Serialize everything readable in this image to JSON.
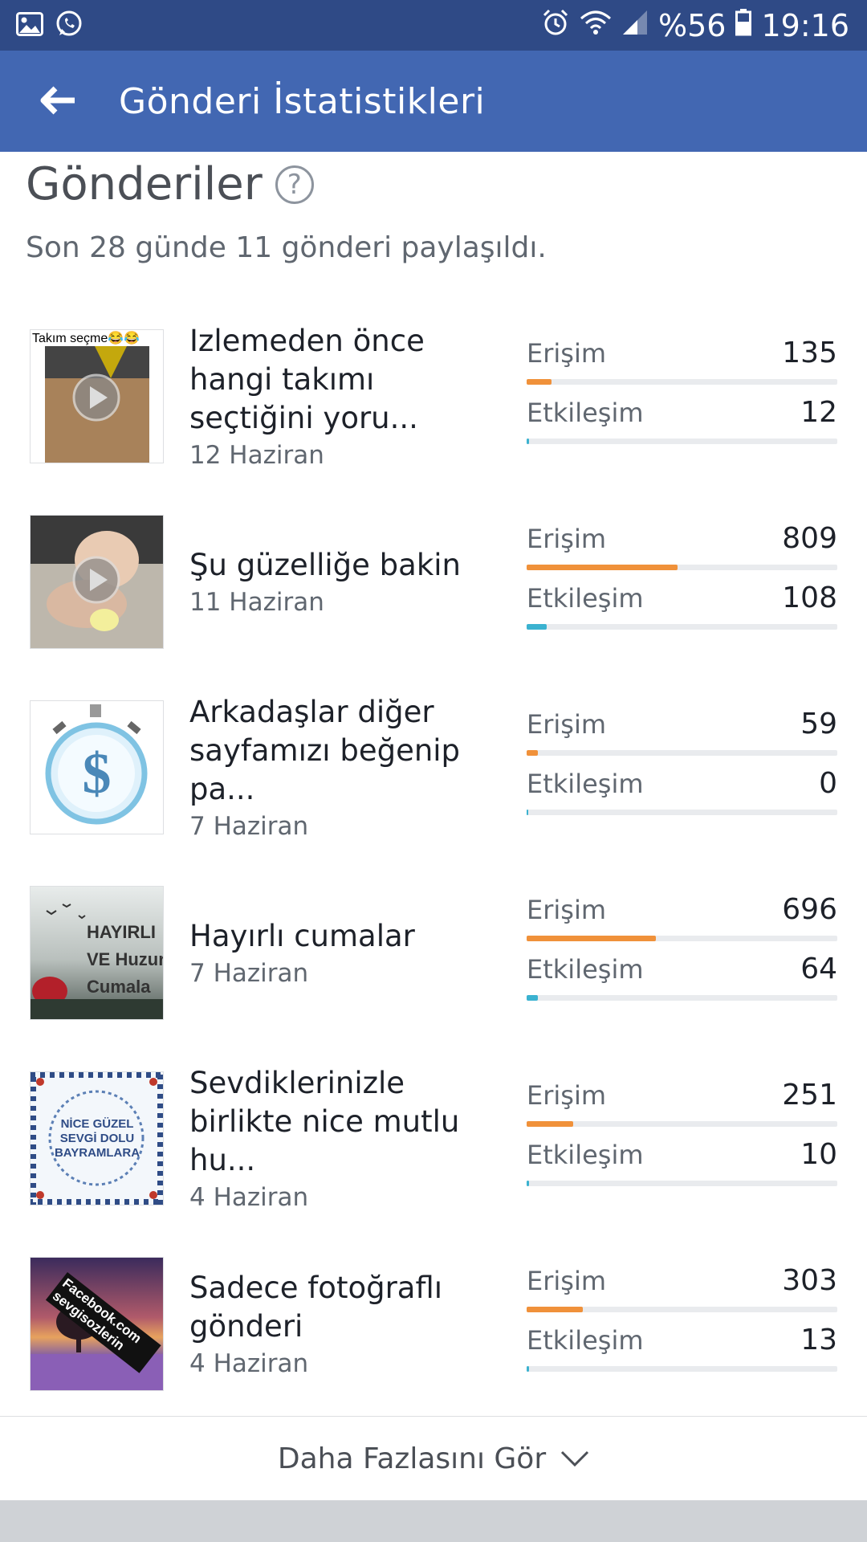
{
  "status_bar": {
    "battery_text": "%56",
    "time": "19:16",
    "icons": [
      "image-icon",
      "whatsapp-icon",
      "alarm-icon",
      "wifi-icon",
      "signal-icon",
      "battery-icon"
    ]
  },
  "app_bar": {
    "title": "Gönderi İstatistikleri",
    "back_icon": "back-arrow-icon",
    "color": "#4267b2"
  },
  "section": {
    "title": "Gönderiler",
    "help_glyph": "?",
    "subtitle": "Son 28 günde 11 gönderi paylaşıldı."
  },
  "metric_labels": {
    "reach": "Erişim",
    "engagement": "Etkileşim"
  },
  "colors": {
    "reach_bar": "#f0913a",
    "engagement_bar": "#3bb2d0",
    "track": "#e9ebee"
  },
  "posts": [
    {
      "title": "Izlemeden önce hangi takımı seçtiğini yoru...",
      "date": "12 Haziran",
      "reach": "135",
      "engagement": "12",
      "reach_fraction": 0.08,
      "engagement_fraction": 0.005,
      "thumb_caption": "Takım seçme😂😂",
      "thumb_type": "video"
    },
    {
      "title": "Şu güzelliğe bakin",
      "date": "11 Haziran",
      "reach": "809",
      "engagement": "108",
      "reach_fraction": 0.485,
      "engagement_fraction": 0.065,
      "thumb_caption": "",
      "thumb_type": "video"
    },
    {
      "title": "Arkadaşlar diğer sayfamızı beğenip pa...",
      "date": "7 Haziran",
      "reach": "59",
      "engagement": "0",
      "reach_fraction": 0.035,
      "engagement_fraction": 0.0,
      "thumb_caption": "$",
      "thumb_type": "stopwatch"
    },
    {
      "title": "Hayırlı cumalar",
      "date": "7 Haziran",
      "reach": "696",
      "engagement": "64",
      "reach_fraction": 0.415,
      "engagement_fraction": 0.035,
      "thumb_caption": "HAYIRLI VE Huzur Cumala",
      "thumb_type": "image"
    },
    {
      "title": "Sevdiklerinizle birlikte nice mutlu hu...",
      "date": "4 Haziran",
      "reach": "251",
      "engagement": "10",
      "reach_fraction": 0.15,
      "engagement_fraction": 0.005,
      "thumb_caption": "NİCE GÜZEL SEVGİ DOLU BAYRAMLARA",
      "thumb_type": "image"
    },
    {
      "title": "Sadece fotoğraflı gönderi",
      "date": "4 Haziran",
      "reach": "303",
      "engagement": "13",
      "reach_fraction": 0.18,
      "engagement_fraction": 0.005,
      "thumb_caption": "Facebook.com sevgisozlerin",
      "thumb_type": "image"
    }
  ],
  "see_more": {
    "label": "Daha Fazlasını Gör"
  }
}
